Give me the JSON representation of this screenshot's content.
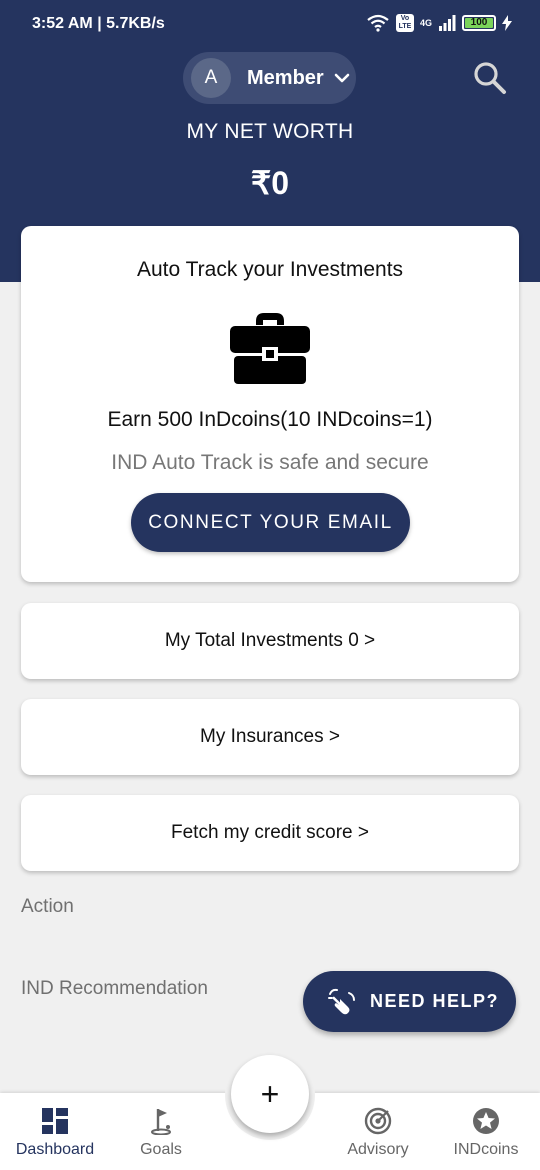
{
  "status_bar": {
    "time_text": "3:52 AM | 5.7KB/s",
    "network_label": "4G",
    "volte_label": "Vo LTE",
    "battery": "100"
  },
  "header": {
    "avatar_initial": "A",
    "member_label": "Member",
    "net_worth_label": "MY NET WORTH",
    "net_worth_value": "₹0"
  },
  "auto_track": {
    "title": "Auto Track your Investments",
    "earn_text": "Earn 500 InDcoins(10 INDcoins=1)",
    "safe_text": "IND Auto Track is safe and secure",
    "connect_label": "CONNECT YOUR EMAIL"
  },
  "cards": {
    "investments": "My Total Investments 0 >",
    "insurances": "My Insurances >",
    "credit": "Fetch my credit score >"
  },
  "sections": {
    "action": "Action",
    "recommendation": "IND Recommendation"
  },
  "help_button": "NEED HELP?",
  "fab": "+",
  "nav": {
    "dashboard": "Dashboard",
    "goals": "Goals",
    "advisory": "Advisory",
    "indcoins": "INDcoins"
  },
  "colors": {
    "brand_navy": "#25345f",
    "background": "#f0f0f0"
  },
  "icons": {
    "search": "search-icon",
    "briefcase": "briefcase-icon",
    "help": "hand-wave-icon",
    "dashboard": "grid-icon",
    "goals": "golf-flag-icon",
    "advisory": "target-icon",
    "indcoins": "star-coin-icon"
  }
}
